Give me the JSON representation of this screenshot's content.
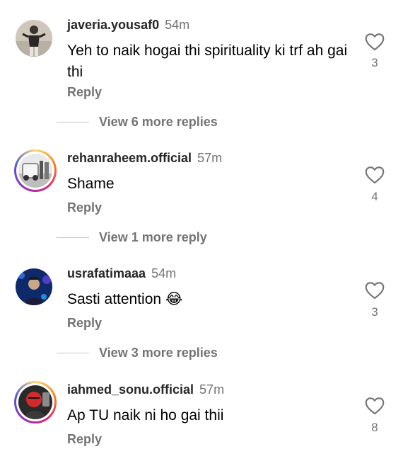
{
  "comments": [
    {
      "username": "javeria.yousaf0",
      "time": "54m",
      "text": "Yeh to naik hogai thi spirituality ki trf ah gai thi",
      "reply_label": "Reply",
      "likes": "3",
      "avatar_icon": "person-photo-avatar",
      "story_ring": false,
      "view_more": "View 6 more replies"
    },
    {
      "username": "rehanraheem.official",
      "time": "57m",
      "text": "Shame",
      "reply_label": "Reply",
      "likes": "4",
      "avatar_icon": "car-photo-avatar",
      "story_ring": true,
      "view_more": "View 1 more reply"
    },
    {
      "username": "usrafatimaaa",
      "time": "54m",
      "text": "Sasti attention 😂",
      "reply_label": "Reply",
      "likes": "3",
      "avatar_icon": "blue-photo-avatar",
      "story_ring": false,
      "view_more": "View 3 more replies"
    },
    {
      "username": "iahmed_sonu.official",
      "time": "57m",
      "text": "Ap TU naik ni ho gai thii",
      "reply_label": "Reply",
      "likes": "8",
      "avatar_icon": "red-photo-avatar",
      "story_ring": true
    }
  ],
  "colors": {
    "username": "#262626",
    "secondary": "#737373",
    "divider": "#c7c7c7",
    "story_ring": [
      "#feda75",
      "#fa7e1e",
      "#d62976",
      "#962fbf",
      "#4f5bd5"
    ]
  },
  "icons": {
    "like": "heart-outline-icon"
  }
}
